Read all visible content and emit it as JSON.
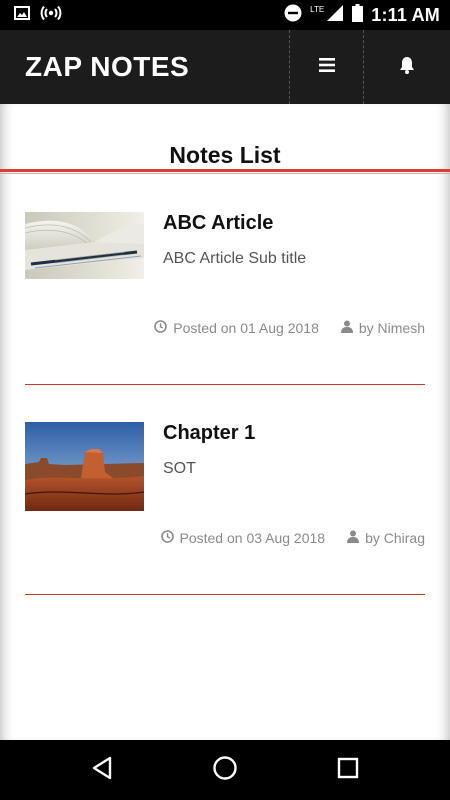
{
  "status_bar": {
    "network": "LTE",
    "time": "1:11 AM"
  },
  "header": {
    "title": "ZAP NOTES",
    "menu_icon": "hamburger-menu-icon",
    "bell_icon": "bell-icon"
  },
  "main": {
    "title": "Notes List",
    "notes": [
      {
        "title": "ABC Article",
        "subtitle": "ABC Article Sub title",
        "posted": "Posted on 01 Aug 2018",
        "author": "by Nimesh",
        "thumbnail": "open-book-image"
      },
      {
        "title": "Chapter 1",
        "subtitle": "SOT",
        "posted": "Posted on 03 Aug 2018",
        "author": "by Chirag",
        "thumbnail": "desert-butte-image"
      }
    ]
  },
  "colors": {
    "header_bg": "#1c1c1c",
    "accent_red": "#d43f3a",
    "meta_gray": "#8a8a8a"
  }
}
